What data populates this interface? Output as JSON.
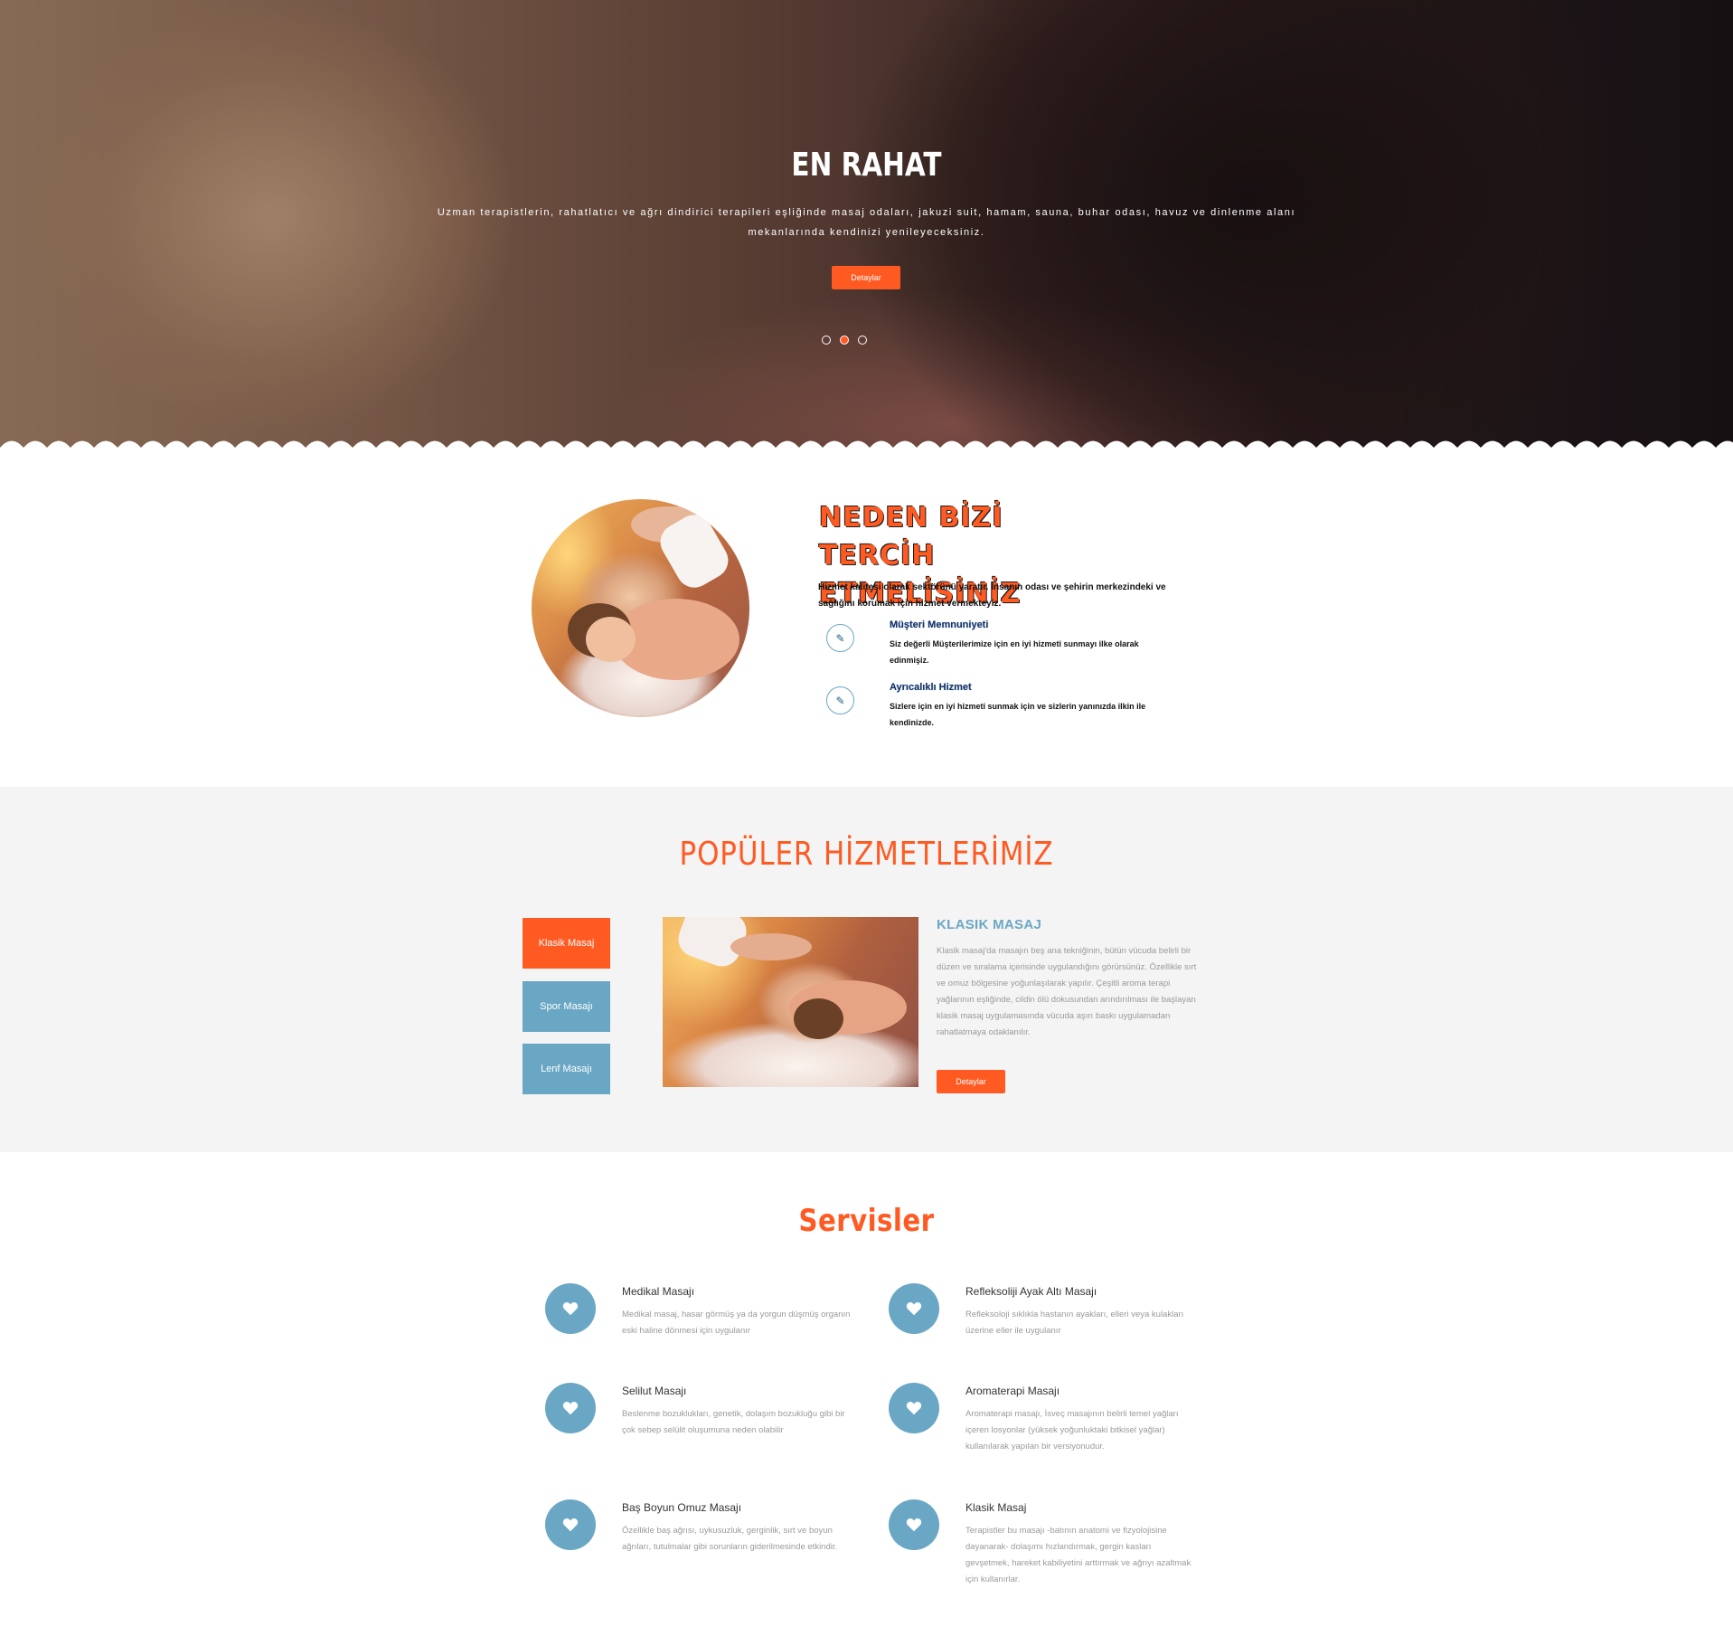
{
  "hero": {
    "title": "EN RAHAT",
    "text": "Uzman terapistlerin, rahatlatıcı ve ağrı dindirici terapileri eşliğinde masaj odaları, jakuzi suit, hamam, sauna, buhar odası, havuz ve dinlenme alanı mekanlarında kendinizi yenileyeceksiniz.",
    "button_label": "Detaylar",
    "slider_active_index": 2,
    "slider_count": 3
  },
  "why": {
    "title": "NEDEN BİZİ TERCİH ETMELİSİNİZ",
    "description": "Hizmet kalitesi olarak sektörünü yaratır. İnsanın odası ve şehirin merkezindeki ve sağlığını korumak için hizmet vermekteyiz.",
    "features": [
      {
        "icon": "pencil-icon",
        "title": "Müşteri Memnuniyeti",
        "text": "Siz değerli Müşterilerimize için en iyi hizmeti sunmayı ilke olarak edinmişiz."
      },
      {
        "icon": "pencil-icon",
        "title": "Ayrıcalıklı Hizmet",
        "text": "Sizlere için en iyi hizmeti sunmak için ve sizlerin yanınızda ilkin ile kendinizde."
      }
    ]
  },
  "popular": {
    "title": "POPÜLER HİZMETLERİMİZ",
    "tabs": [
      {
        "label": "Klasik Masaj",
        "active": true
      },
      {
        "label": "Spor Masajı",
        "active": false
      },
      {
        "label": "Lenf Masajı",
        "active": false
      }
    ],
    "service_name": "KLASIK MASAJ",
    "service_text": "Klasik masaj'da masajın beş ana tekniğinin, bütün vücuda belirli bir düzen ve sıralama içerisinde uygulandığını görürsünüz. Özellikle sırt ve omuz bölgesine yoğunlaşılarak yapılır. Çeşitli aroma terapi yağlarının eşliğinde, cildin ölü dokusundan arındırılması ile başlayan klasik masaj uygulamasında vücuda aşırı baskı uygulamadan rahatlatmaya odaklanılır.",
    "button_label": "Detaylar"
  },
  "services": {
    "title": "Servisler",
    "items": [
      {
        "icon": "heart-icon",
        "title": "Medikal Masajı",
        "text": "Medikal masaj, hasar görmüş ya da yorgun düşmüş organın eski haline dönmesi için uygulanır"
      },
      {
        "icon": "heart-icon",
        "title": "Refleksoliji Ayak Altı Masajı",
        "text": "Refleksoloji sıklıkla hastanın ayakları, elleri veya kulakları üzerine eller ile uygulanır"
      },
      {
        "icon": "heart-icon",
        "title": "Selilut Masajı",
        "text": "Beslenme bozuklukları, genetik, dolaşım bozukluğu gibi bir çok sebep selülit oluşumuna neden olabilir"
      },
      {
        "icon": "heart-icon",
        "title": "Aromaterapi Masajı",
        "text": "Aromaterapi masajı, İsveç masajının belirli temel yağları içeren losyonlar (yüksek yoğunluktaki bitkisel yağlar) kullanılarak yapılan bir versiyonudur."
      },
      {
        "icon": "heart-icon",
        "title": "Baş Boyun Omuz Masajı",
        "text": "Özellikle baş ağrısı, uykusuzluk, gerginlik, sırt ve boyun ağrıları, tutulmalar gibi sorunların giderilmesinde etkindir."
      },
      {
        "icon": "heart-icon",
        "title": "Klasik Masaj",
        "text": "Terapistler bu masajı -batının anatomi ve fizyolojisine dayanarak- dolaşımı hızlandırmak, gergin kasları gevşetmek, hareket kabiliyetini arttırmak ve ağrıyı azaltmak için kullanırlar."
      }
    ]
  },
  "colors": {
    "accent": "#ff5a22",
    "secondary": "#6aa7c4",
    "muted_text": "#9a9a9a",
    "section_bg": "#f4f4f4"
  }
}
